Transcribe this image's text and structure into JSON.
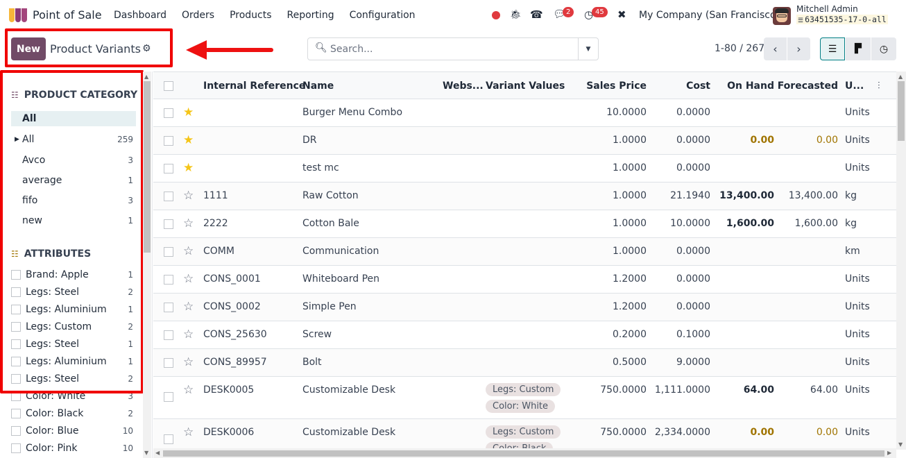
{
  "navbar": {
    "app_name": "Point of Sale",
    "menu": [
      "Dashboard",
      "Orders",
      "Products",
      "Reporting",
      "Configuration"
    ],
    "systray": {
      "recording_icon": "record-dot-icon",
      "debug_icon": "bug-icon",
      "phone_icon": "phone-icon",
      "messages_badge": "2",
      "activities_badge": "45",
      "tools_icon": "tools-icon",
      "company": "My Company (San Francisco)",
      "user_name": "Mitchell Admin",
      "database": "63451535-17-0-all"
    },
    "colors": {
      "brand": "#714b67",
      "badge": "#e0393e",
      "logo": [
        "#f7b73a",
        "#8b3a76",
        "#a3467c"
      ]
    }
  },
  "control_panel": {
    "new_label": "New",
    "title": "Product Variants",
    "search_placeholder": "Search...",
    "pager": "1-80 / 267",
    "highlight_color": "#f00000"
  },
  "sidebar": {
    "category_heading": "PRODUCT CATEGORY",
    "categories": [
      {
        "label": "All",
        "count": "",
        "selected": true
      },
      {
        "label": "All",
        "count": "259",
        "expandable": true
      },
      {
        "label": "Avco",
        "count": "3"
      },
      {
        "label": "average",
        "count": "1"
      },
      {
        "label": "fifo",
        "count": "3"
      },
      {
        "label": "new",
        "count": "1"
      }
    ],
    "attributes_heading": "ATTRIBUTES",
    "attributes": [
      {
        "label": "Brand: Apple",
        "count": "1"
      },
      {
        "label": "Legs: Steel",
        "count": "2"
      },
      {
        "label": "Legs: Aluminium",
        "count": "1"
      },
      {
        "label": "Legs: Custom",
        "count": "2"
      },
      {
        "label": "Legs: Steel",
        "count": "1"
      },
      {
        "label": "Legs: Aluminium",
        "count": "1"
      },
      {
        "label": "Legs: Steel",
        "count": "2"
      },
      {
        "label": "Color: White",
        "count": "3"
      },
      {
        "label": "Color: Black",
        "count": "2"
      },
      {
        "label": "Color: Blue",
        "count": "10"
      },
      {
        "label": "Color: Pink",
        "count": "10"
      }
    ]
  },
  "table": {
    "columns": [
      "Internal Reference",
      "Name",
      "Webs...",
      "Variant Values",
      "Sales Price",
      "Cost",
      "On Hand",
      "Forecasted",
      "U..."
    ],
    "rows": [
      {
        "fav": true,
        "ref": "",
        "name": "Burger Menu Combo",
        "variants": [],
        "price": "10.0000",
        "cost": "0.0000",
        "onhand": "",
        "forecast": "",
        "uom": "Units"
      },
      {
        "fav": true,
        "ref": "",
        "name": "DR",
        "variants": [],
        "price": "1.0000",
        "cost": "0.0000",
        "onhand": "0.00",
        "forecast": "0.00",
        "uom": "Units",
        "zero": true
      },
      {
        "fav": true,
        "ref": "",
        "name": "test mc",
        "variants": [],
        "price": "1.0000",
        "cost": "0.0000",
        "onhand": "",
        "forecast": "",
        "uom": "Units"
      },
      {
        "fav": false,
        "ref": "1111",
        "name": "Raw Cotton",
        "variants": [],
        "price": "1.0000",
        "cost": "21.1940",
        "onhand": "13,400.00",
        "forecast": "13,400.00",
        "uom": "kg"
      },
      {
        "fav": false,
        "ref": "2222",
        "name": "Cotton Bale",
        "variants": [],
        "price": "1.0000",
        "cost": "10.0000",
        "onhand": "1,600.00",
        "forecast": "1,600.00",
        "uom": "kg"
      },
      {
        "fav": false,
        "ref": "COMM",
        "name": "Communication",
        "variants": [],
        "price": "1.0000",
        "cost": "0.0000",
        "onhand": "",
        "forecast": "",
        "uom": "km"
      },
      {
        "fav": false,
        "ref": "CONS_0001",
        "name": "Whiteboard Pen",
        "variants": [],
        "price": "1.2000",
        "cost": "0.0000",
        "onhand": "",
        "forecast": "",
        "uom": "Units"
      },
      {
        "fav": false,
        "ref": "CONS_0002",
        "name": "Simple Pen",
        "variants": [],
        "price": "1.2000",
        "cost": "0.0000",
        "onhand": "",
        "forecast": "",
        "uom": "Units"
      },
      {
        "fav": false,
        "ref": "CONS_25630",
        "name": "Screw",
        "variants": [],
        "price": "0.2000",
        "cost": "0.1000",
        "onhand": "",
        "forecast": "",
        "uom": "Units"
      },
      {
        "fav": false,
        "ref": "CONS_89957",
        "name": "Bolt",
        "variants": [],
        "price": "0.5000",
        "cost": "9.0000",
        "onhand": "",
        "forecast": "",
        "uom": "Units"
      },
      {
        "fav": false,
        "ref": "DESK0005",
        "name": "Customizable Desk",
        "variants": [
          "Legs: Custom",
          "Color: White"
        ],
        "price": "750.0000",
        "cost": "1,111.0000",
        "onhand": "64.00",
        "forecast": "64.00",
        "uom": "Units"
      },
      {
        "fav": false,
        "ref": "DESK0006",
        "name": "Customizable Desk",
        "variants": [
          "Legs: Custom",
          "Color: Black"
        ],
        "price": "750.0000",
        "cost": "2,334.0000",
        "onhand": "0.00",
        "forecast": "0.00",
        "uom": "Units",
        "zero": true
      }
    ]
  }
}
